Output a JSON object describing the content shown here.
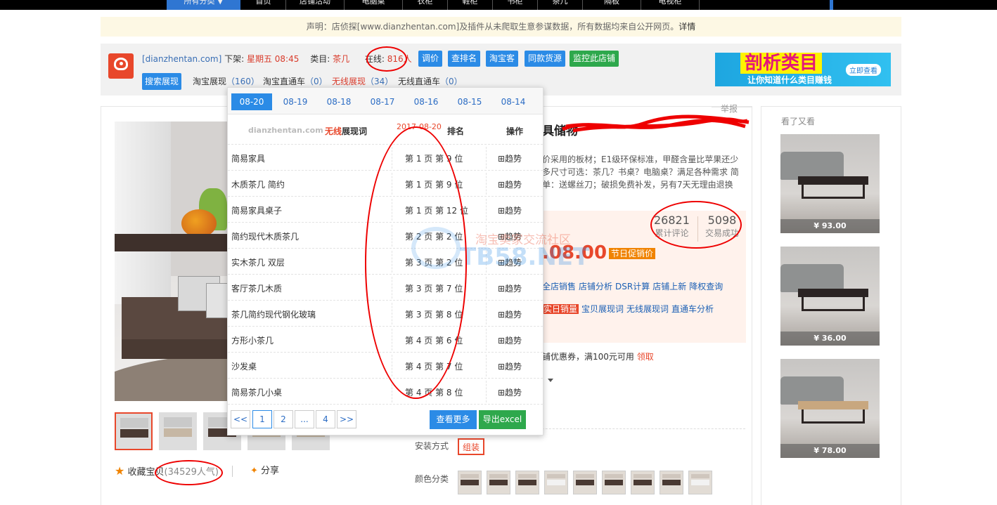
{
  "topnav": {
    "items": [
      "所有分类 ▼",
      "首页",
      "店铺活动",
      "电脑桌",
      "衣柜",
      "鞋柜",
      "书柜",
      "茶几",
      "隔板",
      "电视柜"
    ]
  },
  "notice": {
    "text": "声明：店侦探[www.dianzhentan.com]及插件从未爬取生意参谋数据，所有数据均来自公开网页。",
    "link": "详情"
  },
  "shop": {
    "domain": "[dianzhentan.com]",
    "offline_label": " 下架: ",
    "offline_day": "星期五 08:45",
    "category_label": "类目: ",
    "category": "茶几",
    "online_label": "在线: ",
    "online": "816人",
    "buttons": [
      "调价",
      "查排名",
      "淘宝客",
      "同款货源"
    ],
    "monitor": "监控此店铺",
    "tabs": [
      {
        "label": "搜索展现",
        "count": ""
      },
      {
        "label": "淘宝展现",
        "count": "（160）"
      },
      {
        "label": "淘宝直通车",
        "count": "（0）"
      },
      {
        "label": "无线展现",
        "count": "（34）"
      },
      {
        "label": "无线直通车",
        "count": "（0）"
      }
    ]
  },
  "banner": {
    "big": "剖析类目",
    "small": "让你知道什么类目赚钱",
    "pill": "立即查看"
  },
  "report": "举报",
  "product": {
    "title": "具储物",
    "desc": "价采用的板材；E1级环保标准，甲醛含量比苹果还少 多尺寸可选：茶几？书桌？电脑桌？满足各种需求 简单：送螺丝刀；破损免费补发，另有7天无理由退换",
    "reviews": "26821",
    "reviews_label": "累计评论",
    "deals": "5098",
    "deals_label": "交易成功",
    "price": ".08.00",
    "promo": "节日促销价",
    "links1": [
      "全店销售",
      "店铺分析",
      "DSR计算",
      "店铺上新",
      "降权查询"
    ],
    "links2_red": "实日销量",
    "links2": [
      "宝贝展现词",
      "无线展现词",
      "直通车分析"
    ],
    "coupon_text": "铺优惠券，满100元可用",
    "coupon_get": "领取",
    "install_label": "安装方式",
    "install_value": "组装",
    "color_label": "颜色分类",
    "fav_label": "收藏宝贝",
    "fav_count": "(34529人气)",
    "share": "分享"
  },
  "sidebar": {
    "title": "看了又看",
    "items": [
      {
        "price": "¥ 93.00"
      },
      {
        "price": "¥ 36.00"
      },
      {
        "price": "¥ 78.00"
      }
    ]
  },
  "popup": {
    "dates": [
      "08-20",
      "08-19",
      "08-18",
      "08-17",
      "08-16",
      "08-15",
      "08-14"
    ],
    "brand": "dianzhentan.com",
    "kw_red": "无线",
    "kw_rest": "展现词",
    "date": "2017-08-20",
    "rank_h": "排名",
    "op_h": "操作",
    "rows": [
      {
        "word": "简易家具",
        "rank": "第 1 页 第 9 位",
        "trend": "⊞趋势"
      },
      {
        "word": "木质茶几 简约",
        "rank": "第 1 页 第 9 位",
        "trend": "⊞趋势"
      },
      {
        "word": "简易家具桌子",
        "rank": "第 1 页 第 12 位",
        "trend": "⊞趋势"
      },
      {
        "word": "简约现代木质茶几",
        "rank": "第 2 页 第 2 位",
        "trend": "⊞趋势"
      },
      {
        "word": "实木茶几 双层",
        "rank": "第 3 页 第 2 位",
        "trend": "⊞趋势"
      },
      {
        "word": "客厅茶几木质",
        "rank": "第 3 页 第 7 位",
        "trend": "⊞趋势"
      },
      {
        "word": "茶几简约现代钢化玻璃",
        "rank": "第 3 页 第 8 位",
        "trend": "⊞趋势"
      },
      {
        "word": "方形小茶几",
        "rank": "第 4 页 第 6 位",
        "trend": "⊞趋势"
      },
      {
        "word": "沙发桌",
        "rank": "第 4 页 第 7 位",
        "trend": "⊞趋势"
      },
      {
        "word": "简易茶几小桌",
        "rank": "第 4 页 第 8 位",
        "trend": "⊞趋势"
      }
    ],
    "pages": [
      "<<",
      "1",
      "2",
      "...",
      "4",
      ">>"
    ],
    "more": "查看更多",
    "excel": "导出excel"
  },
  "watermark": {
    "line1": "淘宝卖家交流社区",
    "line2": "TB58.NET"
  },
  "colors": {
    "accent": "#2b8be6",
    "brand_red": "#e8472b",
    "green": "#2ea84c"
  }
}
